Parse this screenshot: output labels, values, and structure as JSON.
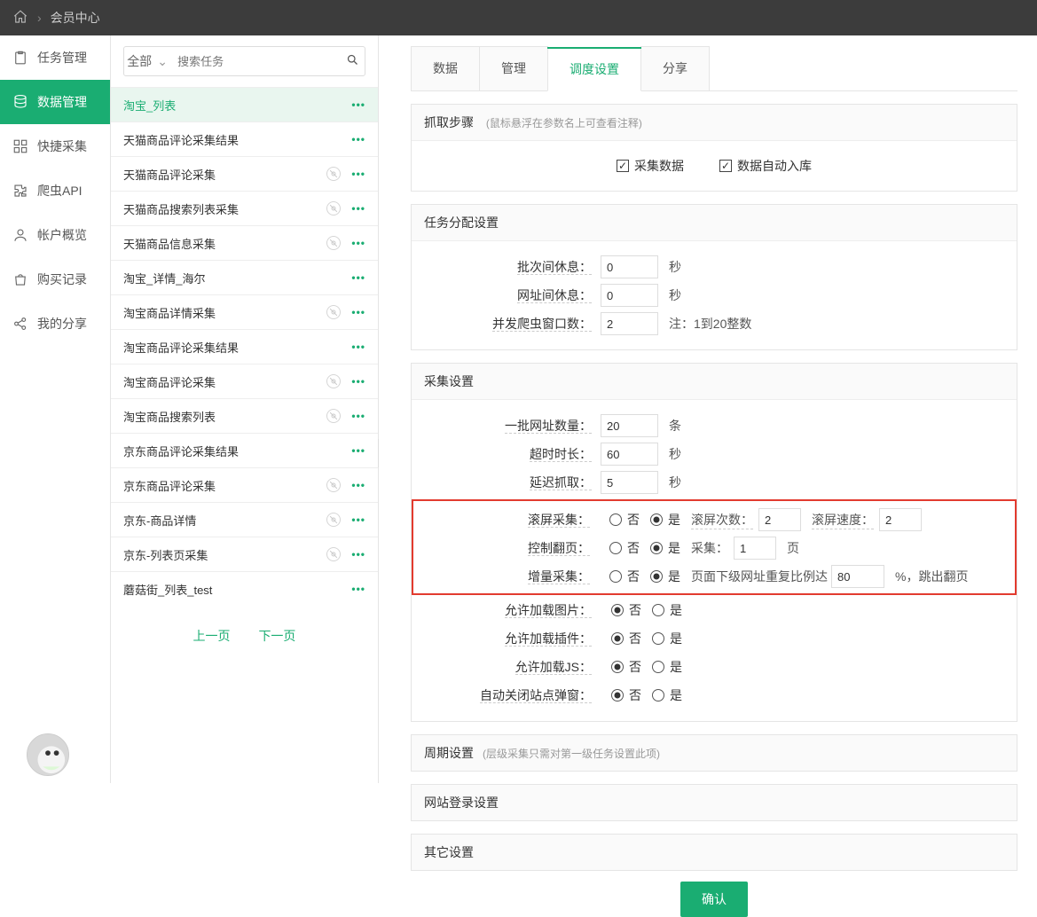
{
  "breadcrumb": {
    "title": "会员中心"
  },
  "sidebar": {
    "items": [
      "任务管理",
      "数据管理",
      "快捷采集",
      "爬虫API",
      "帐户概览",
      "购买记录",
      "我的分享"
    ],
    "active_index": 1
  },
  "search": {
    "scope": "全部",
    "placeholder": "搜索任务"
  },
  "tasks": [
    {
      "name": "淘宝_列表",
      "has_compass": false,
      "active": true
    },
    {
      "name": "天猫商品评论采集结果",
      "has_compass": false
    },
    {
      "name": "天猫商品评论采集",
      "has_compass": true
    },
    {
      "name": "天猫商品搜索列表采集",
      "has_compass": true
    },
    {
      "name": "天猫商品信息采集",
      "has_compass": true
    },
    {
      "name": "淘宝_详情_海尔",
      "has_compass": false
    },
    {
      "name": "淘宝商品详情采集",
      "has_compass": true
    },
    {
      "name": "淘宝商品评论采集结果",
      "has_compass": false
    },
    {
      "name": "淘宝商品评论采集",
      "has_compass": true
    },
    {
      "name": "淘宝商品搜索列表",
      "has_compass": true
    },
    {
      "name": "京东商品评论采集结果",
      "has_compass": false
    },
    {
      "name": "京东商品评论采集",
      "has_compass": true
    },
    {
      "name": "京东-商品详情",
      "has_compass": true
    },
    {
      "name": "京东-列表页采集",
      "has_compass": true
    },
    {
      "name": "蘑菇街_列表_test",
      "has_compass": false
    }
  ],
  "pager": {
    "prev": "上一页",
    "next": "下一页"
  },
  "tabs": {
    "items": [
      "数据",
      "管理",
      "调度设置",
      "分享"
    ],
    "active_index": 2
  },
  "sections": {
    "steps": {
      "title": "抓取步骤",
      "hint": "(鼠标悬浮在参数名上可查看注释)",
      "cb1": {
        "label": "采集数据",
        "checked": true
      },
      "cb2": {
        "label": "数据自动入库",
        "checked": true
      }
    },
    "alloc": {
      "title": "任务分配设置",
      "rows": [
        {
          "label": "批次间休息：",
          "value": "0",
          "unit": "秒"
        },
        {
          "label": "网址间休息：",
          "value": "0",
          "unit": "秒"
        },
        {
          "label": "并发爬虫窗口数：",
          "value": "2",
          "unit": "注：1到20整数"
        }
      ]
    },
    "collect": {
      "title": "采集设置",
      "urlBatch": {
        "label": "一批网址数量：",
        "value": "20",
        "unit": "条"
      },
      "timeout": {
        "label": "超时时长：",
        "value": "60",
        "unit": "秒"
      },
      "delay": {
        "label": "延迟抓取：",
        "value": "5",
        "unit": "秒"
      },
      "scroll": {
        "label": "滚屏采集：",
        "no": "否",
        "yes": "是",
        "val": "yes",
        "countLabel": "滚屏次数：",
        "count": "2",
        "speedLabel": "滚屏速度：",
        "speed": "2"
      },
      "page": {
        "label": "控制翻页：",
        "no": "否",
        "yes": "是",
        "val": "yes",
        "countLabel": "采集：",
        "count": "1",
        "unit": "页"
      },
      "incr": {
        "label": "增量采集：",
        "no": "否",
        "yes": "是",
        "val": "yes",
        "pre": "页面下级网址重复比例达",
        "value": "80",
        "post": "%，跳出翻页"
      },
      "bools": [
        {
          "label": "允许加载图片：",
          "no": "否",
          "yes": "是",
          "val": "no"
        },
        {
          "label": "允许加载插件：",
          "no": "否",
          "yes": "是",
          "val": "no"
        },
        {
          "label": "允许加载JS：",
          "no": "否",
          "yes": "是",
          "val": "no"
        },
        {
          "label": "自动关闭站点弹窗：",
          "no": "否",
          "yes": "是",
          "val": "no"
        }
      ]
    },
    "period": {
      "title": "周期设置",
      "hint": "(层级采集只需对第一级任务设置此项)"
    },
    "login": {
      "title": "网站登录设置"
    },
    "other": {
      "title": "其它设置"
    }
  },
  "confirmLabel": "确认"
}
